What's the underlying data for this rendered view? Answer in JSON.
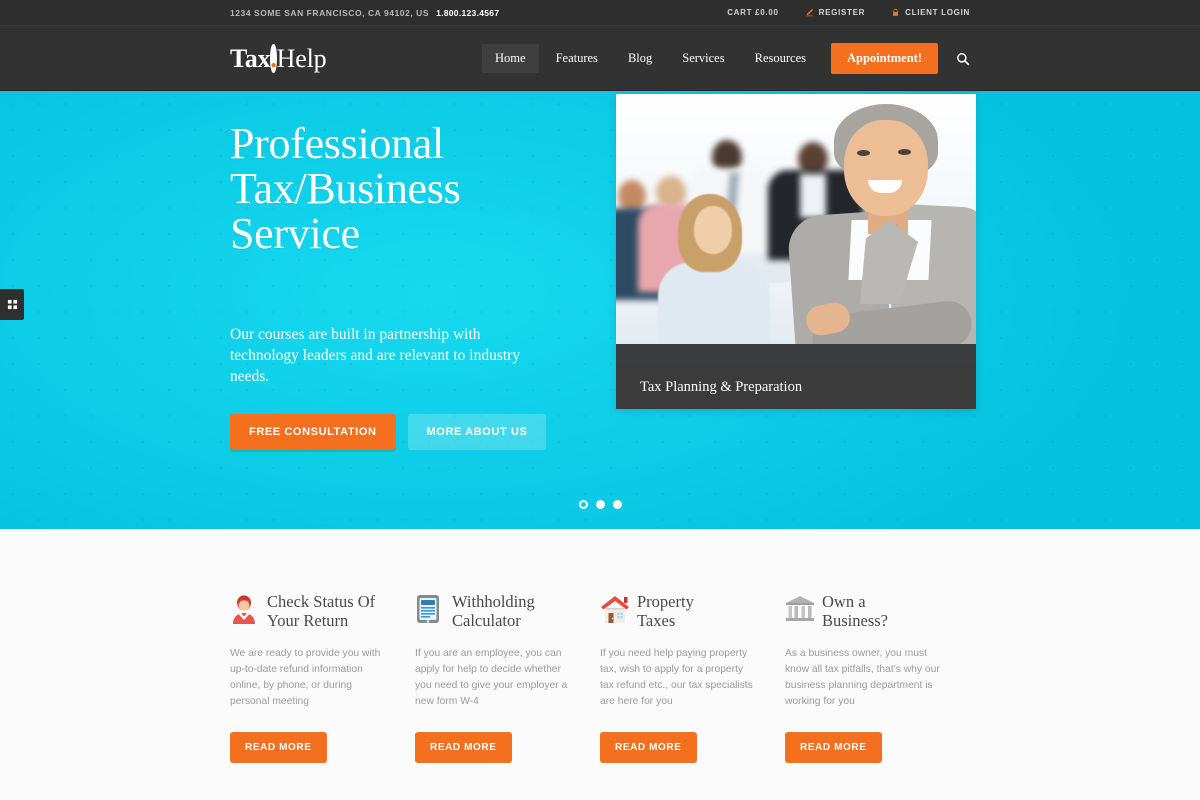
{
  "topbar": {
    "address": "1234 SOME SAN FRANCISCO, CA 94102, US",
    "phone": "1.800.123.4567",
    "cart": "CART £0.00",
    "register": "REGISTER",
    "client_login": "CLIENT LOGIN"
  },
  "header": {
    "logo_bold": "Tax",
    "logo_dot": ".",
    "logo_light": "Help",
    "nav": [
      {
        "label": "Home",
        "active": true
      },
      {
        "label": "Features",
        "active": false
      },
      {
        "label": "Blog",
        "active": false
      },
      {
        "label": "Services",
        "active": false
      },
      {
        "label": "Resources",
        "active": false
      }
    ],
    "cta": "Appointment!",
    "search_icon": "search-icon"
  },
  "hero": {
    "title_line1": "Professional",
    "title_line2": "Tax/Business",
    "title_line3": "Service",
    "subtitle": "Our courses are built in partnership with technology leaders and are relevant to industry needs.",
    "primary_button": "FREE CONSULTATION",
    "secondary_button": "MORE ABOUT US",
    "image_caption": "Tax Planning & Preparation",
    "slides": 3,
    "active_slide": 1,
    "accent_color": "#0fcfe8",
    "orange_color": "#f4701f"
  },
  "features": [
    {
      "icon": "person-icon",
      "title_line1": "Check Status Of",
      "title_line2": "Your Return",
      "text": "We are ready to provide you with up-to-date refund information online, by phone, or during personal meeting",
      "button": "READ MORE"
    },
    {
      "icon": "calculator-icon",
      "title_line1": "Withholding",
      "title_line2": "Calculator",
      "text": "If you are an employee, you can apply for help to decide whether you need to give your employer a new form W-4",
      "button": "READ MORE"
    },
    {
      "icon": "house-icon",
      "title_line1": "Property",
      "title_line2": "Taxes",
      "text": "If you need help paying property tax, wish to apply for a property tax refund etc., our tax specialists are here for you",
      "button": "READ MORE"
    },
    {
      "icon": "bank-icon",
      "title_line1": "Own a",
      "title_line2": "Business?",
      "text": "As a business owner, you must know all tax pitfalls, that's why our business planning department is working for you",
      "button": "READ MORE"
    }
  ]
}
